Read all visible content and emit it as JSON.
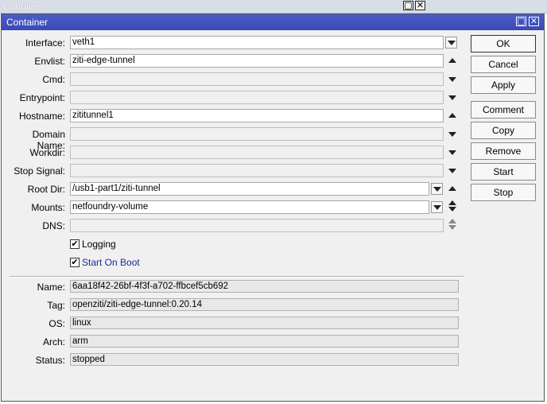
{
  "background_window": {
    "title": "Container",
    "controls": [
      "restore-icon",
      "close-icon"
    ]
  },
  "dialog": {
    "title": "Container",
    "fields": [
      {
        "label": "Interface:",
        "value": "veth1"
      },
      {
        "label": "Envlist:",
        "value": "ziti-edge-tunnel"
      },
      {
        "label": "Cmd:",
        "value": ""
      },
      {
        "label": "Entrypoint:",
        "value": ""
      },
      {
        "label": "Hostname:",
        "value": "zititunnel1"
      },
      {
        "label": "Domain Name:",
        "value": ""
      },
      {
        "label": "Workdir:",
        "value": ""
      },
      {
        "label": "Stop Signal:",
        "value": ""
      },
      {
        "label": "Root Dir:",
        "value": "/usb1-part1/ziti-tunnel"
      },
      {
        "label": "Mounts:",
        "value": "netfoundry-volume"
      },
      {
        "label": "DNS:",
        "value": ""
      }
    ],
    "checkboxes": {
      "logging": {
        "label": "Logging",
        "checked": "✔"
      },
      "start_on_boot": {
        "label": "Start On Boot",
        "checked": "✔"
      }
    },
    "info": [
      {
        "label": "Name:",
        "value": "6aa18f42-26bf-4f3f-a702-ffbcef5cb692"
      },
      {
        "label": "Tag:",
        "value": "openziti/ziti-edge-tunnel:0.20.14"
      },
      {
        "label": "OS:",
        "value": "linux"
      },
      {
        "label": "Arch:",
        "value": "arm"
      },
      {
        "label": "Status:",
        "value": "stopped"
      }
    ],
    "buttons": {
      "ok": "OK",
      "cancel": "Cancel",
      "apply": "Apply",
      "comment": "Comment",
      "copy": "Copy",
      "remove": "Remove",
      "start": "Start",
      "stop": "Stop"
    }
  },
  "colors": {
    "title_bar": "#3f4fbc",
    "link_text": "#1a2a9a"
  }
}
